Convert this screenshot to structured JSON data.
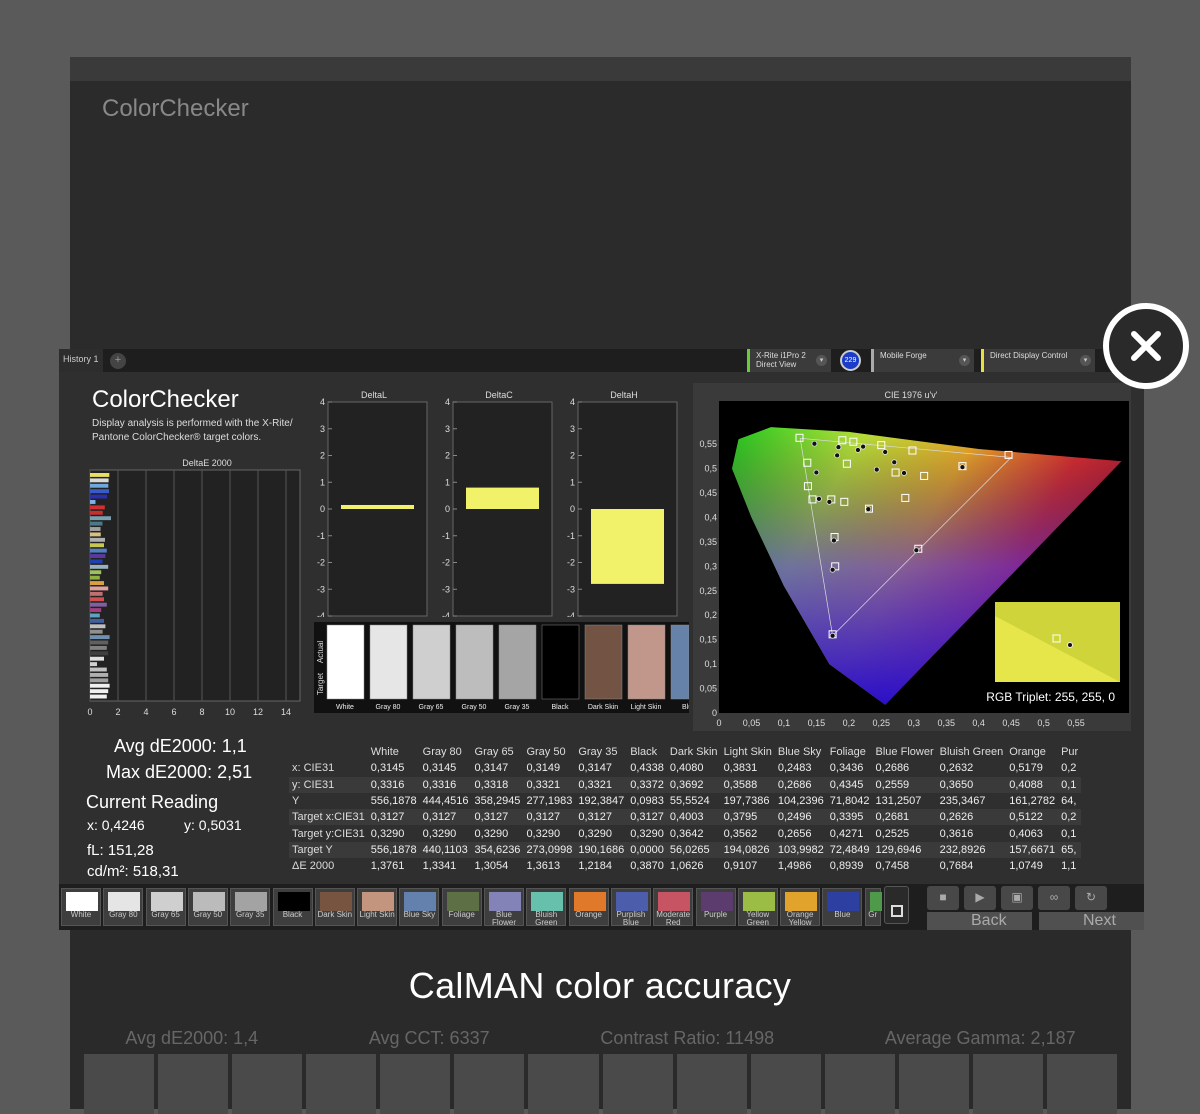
{
  "caption": "CalMAN color accuracy",
  "toolbar": {
    "history_tab": "History 1",
    "add_tab": "+",
    "meter_line1": "X-Rite i1Pro 2",
    "meter_line2": "Direct View",
    "badge": "229",
    "source": "Mobile Forge",
    "display": "Direct Display Control"
  },
  "panel": {
    "title": "ColorChecker",
    "subtitle": "Display analysis is performed with the X-Rite/ Pantone ColorChecker® target colors.",
    "avg_de": "Avg dE2000: 1,1",
    "max_de": "Max dE2000: 2,51",
    "current_reading": "Current Reading",
    "x_value": "x: 0,4246",
    "y_value": "y: 0,5031",
    "fl_value": "fL: 151,28",
    "cdm2_value": "cd/m²: 518,31",
    "rgb_triplet": "RGB Triplet: 255, 255, 0"
  },
  "chart_data": [
    {
      "type": "bar",
      "title": "DeltaE 2000",
      "orientation": "horizontal",
      "xlim": [
        0,
        15
      ],
      "ticks": [
        "0",
        "2",
        "4",
        "6",
        "8",
        "10",
        "12",
        "14"
      ],
      "values": [
        1.38,
        1.33,
        1.31,
        1.36,
        1.22,
        0.39,
        1.06,
        0.91,
        1.5,
        0.89,
        0.75,
        0.77,
        1.07,
        1.0,
        1.2,
        1.1,
        0.9,
        1.3,
        0.8,
        0.7,
        1.0,
        1.3,
        0.9,
        1.0,
        1.2,
        0.8,
        0.7,
        1.0,
        1.1,
        0.9,
        1.4,
        1.3,
        1.2,
        1.3,
        1.0,
        0.5,
        1.2,
        1.3,
        1.3,
        1.4,
        1.3,
        1.2
      ],
      "colors": [
        "#e8e060",
        "#d8d8d8",
        "#6fa8dc",
        "#3a5ac8",
        "#2830b0",
        "#7fb3e8",
        "#d03030",
        "#c83030",
        "#7a9fb0",
        "#4a7a8a",
        "#a0a0a0",
        "#d8c080",
        "#b0b0b0",
        "#c8c850",
        "#5080c0",
        "#5a3aa0",
        "#2040b0",
        "#9ab0c0",
        "#a0c060",
        "#90b040",
        "#d8a040",
        "#e0a0a0",
        "#c07070",
        "#d05050",
        "#8060a0",
        "#a04080",
        "#60a0c0",
        "#4060a0",
        "#c0c0c0",
        "#909090",
        "#7090b0",
        "#606060",
        "#808080",
        "#404040",
        "#e0e0e0",
        "#d0d0d0",
        "#c0c0c0",
        "#b0b0b0",
        "#a0a0a0",
        "#f0f0f0",
        "#f0f0f0",
        "#f0f0f0"
      ]
    },
    {
      "type": "bar",
      "title": "DeltaL",
      "ylim": [
        -4,
        4
      ],
      "ticks": [
        "4",
        "3",
        "2",
        "1",
        "0",
        "-1",
        "-2",
        "-3",
        "-4"
      ],
      "values": [
        0.15
      ]
    },
    {
      "type": "bar",
      "title": "DeltaC",
      "ylim": [
        -4,
        4
      ],
      "ticks": [
        "4",
        "3",
        "2",
        "1",
        "0",
        "-1",
        "-2",
        "-3",
        "-4"
      ],
      "values": [
        0.8
      ]
    },
    {
      "type": "bar",
      "title": "DeltaH",
      "ylim": [
        -4,
        4
      ],
      "ticks": [
        "4",
        "3",
        "2",
        "1",
        "0",
        "-1",
        "-2",
        "-3",
        "-4"
      ],
      "values": [
        -2.8
      ]
    },
    {
      "type": "scatter",
      "title": "CIE 1976 u'v'",
      "xlim": [
        0,
        0.6
      ],
      "ylim": [
        0,
        0.6
      ],
      "xticks": [
        "0",
        "0,05",
        "0,1",
        "0,15",
        "0,2",
        "0,25",
        "0,3",
        "0,35",
        "0,4",
        "0,45",
        "0,5",
        "0,55"
      ],
      "yticks": [
        "0,55",
        "0,5",
        "0,45",
        "0,4",
        "0,35",
        "0,3",
        "0,25",
        "0,2",
        "0,15",
        "0,1",
        "0,05",
        "0"
      ],
      "targets": [
        [
          0.124,
          0.563
        ],
        [
          0.19,
          0.558
        ],
        [
          0.207,
          0.555
        ],
        [
          0.25,
          0.548
        ],
        [
          0.298,
          0.537
        ],
        [
          0.136,
          0.512
        ],
        [
          0.197,
          0.51
        ],
        [
          0.272,
          0.492
        ],
        [
          0.375,
          0.505
        ],
        [
          0.446,
          0.528
        ],
        [
          0.316,
          0.485
        ],
        [
          0.137,
          0.464
        ],
        [
          0.144,
          0.437
        ],
        [
          0.173,
          0.437
        ],
        [
          0.193,
          0.432
        ],
        [
          0.231,
          0.418
        ],
        [
          0.287,
          0.44
        ],
        [
          0.178,
          0.36
        ],
        [
          0.307,
          0.336
        ],
        [
          0.179,
          0.3
        ],
        [
          0.175,
          0.161
        ]
      ],
      "measured": [
        [
          0.147,
          0.551
        ],
        [
          0.184,
          0.544
        ],
        [
          0.182,
          0.527
        ],
        [
          0.222,
          0.545
        ],
        [
          0.256,
          0.534
        ],
        [
          0.15,
          0.492
        ],
        [
          0.243,
          0.498
        ],
        [
          0.285,
          0.491
        ],
        [
          0.375,
          0.503
        ],
        [
          0.214,
          0.538
        ],
        [
          0.154,
          0.438
        ],
        [
          0.17,
          0.432
        ],
        [
          0.23,
          0.417
        ],
        [
          0.177,
          0.353
        ],
        [
          0.304,
          0.333
        ],
        [
          0.175,
          0.293
        ],
        [
          0.175,
          0.158
        ],
        [
          0.27,
          0.513
        ]
      ]
    }
  ],
  "swatch_panel": {
    "labels": [
      "White",
      "Gray 80",
      "Gray 65",
      "Gray 50",
      "Gray 35",
      "Black",
      "Dark Skin",
      "Light Skin",
      "Blue"
    ],
    "colors": [
      "#ffffff",
      "#e6e6e6",
      "#cfcfcf",
      "#bdbdbd",
      "#a5a5a5",
      "#000000",
      "#735444",
      "#c0978a",
      "#6682a8"
    ],
    "row_actual": "Actual",
    "row_target": "Target"
  },
  "table": {
    "headers": [
      "",
      "White",
      "Gray 80",
      "Gray 65",
      "Gray 50",
      "Gray 35",
      "Black",
      "Dark Skin",
      "Light Skin",
      "Blue Sky",
      "Foliage",
      "Blue Flower",
      "Bluish Green",
      "Orange",
      "Pur"
    ],
    "rows": [
      [
        "x: CIE31",
        "0,3145",
        "0,3145",
        "0,3147",
        "0,3149",
        "0,3147",
        "0,4338",
        "0,4080",
        "0,3831",
        "0,2483",
        "0,3436",
        "0,2686",
        "0,2632",
        "0,5179",
        "0,2"
      ],
      [
        "y: CIE31",
        "0,3316",
        "0,3316",
        "0,3318",
        "0,3321",
        "0,3321",
        "0,3372",
        "0,3692",
        "0,3588",
        "0,2686",
        "0,4345",
        "0,2559",
        "0,3650",
        "0,4088",
        "0,1"
      ],
      [
        "Y",
        "556,1878",
        "444,4516",
        "358,2945",
        "277,1983",
        "192,3847",
        "0,0983",
        "55,5524",
        "197,7386",
        "104,2396",
        "71,8042",
        "131,2507",
        "235,3467",
        "161,2782",
        "64,"
      ],
      [
        "Target x:CIE31",
        "0,3127",
        "0,3127",
        "0,3127",
        "0,3127",
        "0,3127",
        "0,3127",
        "0,4003",
        "0,3795",
        "0,2496",
        "0,3395",
        "0,2681",
        "0,2626",
        "0,5122",
        "0,2"
      ],
      [
        "Target y:CIE31",
        "0,3290",
        "0,3290",
        "0,3290",
        "0,3290",
        "0,3290",
        "0,3290",
        "0,3642",
        "0,3562",
        "0,2656",
        "0,4271",
        "0,2525",
        "0,3616",
        "0,4063",
        "0,1"
      ],
      [
        "Target Y",
        "556,1878",
        "440,1103",
        "354,6236",
        "273,0998",
        "190,1686",
        "0,0000",
        "56,0265",
        "194,0826",
        "103,9982",
        "72,4849",
        "129,6946",
        "232,8926",
        "157,6671",
        "65,"
      ],
      [
        "ΔE 2000",
        "1,3761",
        "1,3341",
        "1,3054",
        "1,3613",
        "1,2184",
        "0,3870",
        "1,0626",
        "0,9107",
        "1,4986",
        "0,8939",
        "0,7458",
        "0,7684",
        "1,0749",
        "1,1"
      ]
    ]
  },
  "swatches": [
    {
      "label": "White",
      "color": "#ffffff"
    },
    {
      "label": "Gray 80",
      "color": "#e5e5e5"
    },
    {
      "label": "Gray 65",
      "color": "#cfcfcf"
    },
    {
      "label": "Gray 50",
      "color": "#bbbbbb"
    },
    {
      "label": "Gray 35",
      "color": "#a3a3a3"
    },
    {
      "label": "Black",
      "color": "#000000"
    },
    {
      "label": "Dark Skin",
      "color": "#76543f"
    },
    {
      "label": "Light Skin",
      "color": "#c3957e"
    },
    {
      "label": "Blue Sky",
      "color": "#6481ad"
    },
    {
      "label": "Foliage",
      "color": "#5d7045"
    },
    {
      "label": "Blue Flower",
      "color": "#8483b7"
    },
    {
      "label": "Bluish Green",
      "color": "#66c0ac"
    },
    {
      "label": "Orange",
      "color": "#e07a2a"
    },
    {
      "label": "Purplish Blue",
      "color": "#4c5dac"
    },
    {
      "label": "Moderate Red",
      "color": "#c75463"
    },
    {
      "label": "Purple",
      "color": "#5c3c6e"
    },
    {
      "label": "Yellow Green",
      "color": "#9cbd45"
    },
    {
      "label": "Orange Yellow",
      "color": "#e2a32c"
    },
    {
      "label": "Blue",
      "color": "#2d3fa0"
    },
    {
      "label": "Gr",
      "color": "#4f9a4a"
    }
  ],
  "nav": {
    "back": "Back",
    "next": "Next"
  },
  "background": {
    "title": "ColorChecker",
    "stats": [
      "Avg dE2000: 1,4",
      "Avg CCT: 6337",
      "Contrast Ratio: 11498",
      "Average Gamma: 2,187"
    ]
  }
}
